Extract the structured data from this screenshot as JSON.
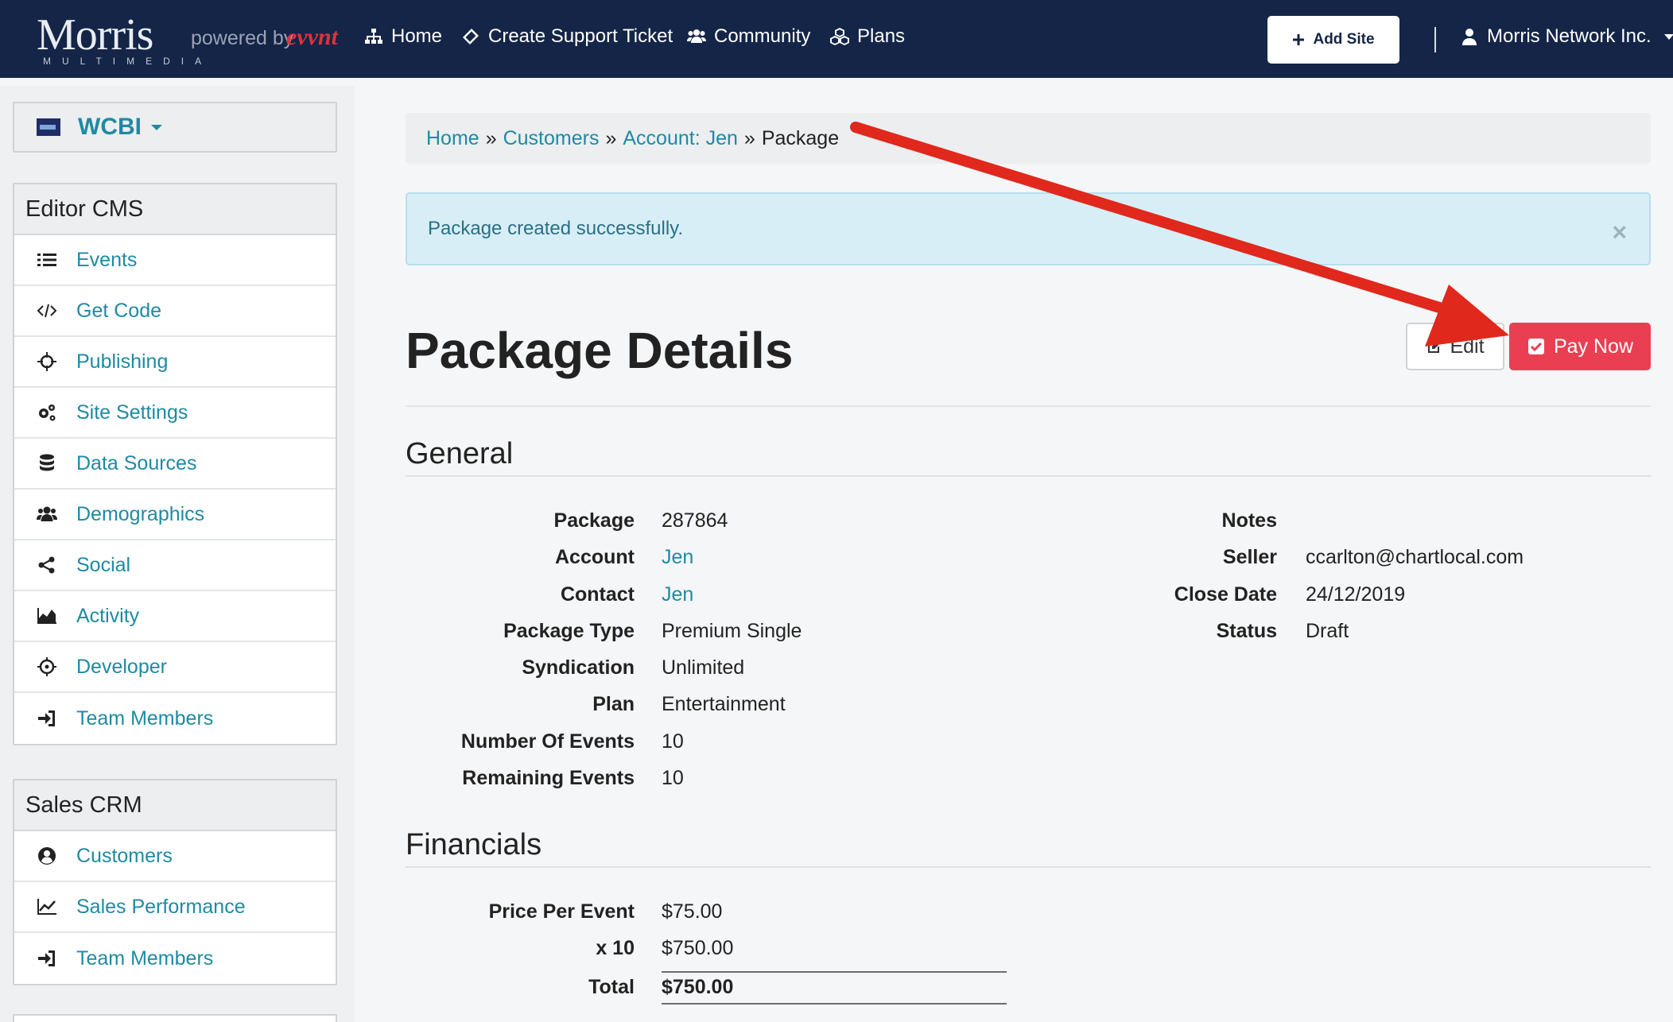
{
  "navbar": {
    "logo_brand": "Morris",
    "logo_sub": "MULTIMEDIA",
    "logo_powered": "powered by",
    "logo_evvnt": "evvnt",
    "links": [
      {
        "label": "Home",
        "icon": "sitemap-icon"
      },
      {
        "label": "Create Support Ticket",
        "icon": "ticket-icon"
      },
      {
        "label": "Community",
        "icon": "users-icon"
      },
      {
        "label": "Plans",
        "icon": "cubes-icon"
      }
    ],
    "add_site_label": "Add Site",
    "user_label": "Morris Network Inc."
  },
  "sidebar": {
    "site_name": "WCBI",
    "editor_cms": {
      "title": "Editor CMS",
      "items": [
        "Events",
        "Get Code",
        "Publishing",
        "Site Settings",
        "Data Sources",
        "Demographics",
        "Social",
        "Activity",
        "Developer",
        "Team Members"
      ]
    },
    "sales_crm": {
      "title": "Sales CRM",
      "items": [
        "Customers",
        "Sales Performance",
        "Team Members"
      ]
    }
  },
  "breadcrumb": {
    "items": [
      "Home",
      "Customers",
      "Account: Jen"
    ],
    "separator": "»",
    "current": "Package"
  },
  "alert": {
    "message": "Package created successfully.",
    "close": "×"
  },
  "page": {
    "title": "Package Details",
    "edit_label": "Edit",
    "pay_label": "Pay Now"
  },
  "general": {
    "title": "General",
    "left": [
      {
        "label": "Package",
        "value": "287864"
      },
      {
        "label": "Account",
        "value": "Jen"
      },
      {
        "label": "Contact",
        "value": "Jen"
      },
      {
        "label": "Package Type",
        "value": "Premium Single"
      },
      {
        "label": "Syndication",
        "value": "Unlimited"
      },
      {
        "label": "Plan",
        "value": "Entertainment"
      },
      {
        "label": "Number Of Events",
        "value": "10"
      },
      {
        "label": "Remaining Events",
        "value": "10"
      }
    ],
    "right": [
      {
        "label": "Notes",
        "value": ""
      },
      {
        "label": "Seller",
        "value": "ccarlton@chartlocal.com"
      },
      {
        "label": "Close Date",
        "value": "24/12/2019"
      },
      {
        "label": "Status",
        "value": "Draft"
      }
    ]
  },
  "financials": {
    "title": "Financials",
    "rows": [
      {
        "label": "Price Per Event",
        "value": "$75.00"
      },
      {
        "label": "x 10",
        "value": "$750.00"
      },
      {
        "label": "Total",
        "value": "$750.00"
      }
    ]
  },
  "colors": {
    "navbar": "#142547",
    "link": "#1f8aa3",
    "pay_button": "#ea3f52",
    "alert_bg": "#d8eef6",
    "annotation_arrow": "#e0281c"
  }
}
